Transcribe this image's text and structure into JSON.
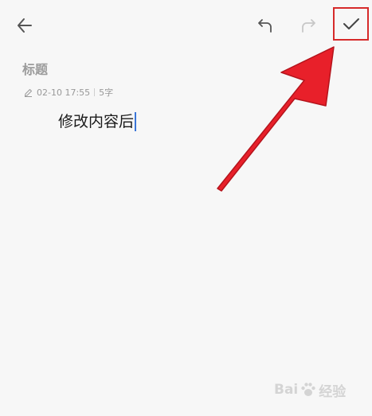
{
  "toolbar": {
    "back_icon": "arrow-left-icon",
    "undo_icon": "undo-icon",
    "redo_icon": "redo-icon",
    "confirm_icon": "checkmark-icon",
    "confirm_highlight_color": "#d62a2a"
  },
  "note": {
    "title": "标题",
    "edit_icon": "pencil-icon",
    "timestamp": "02-10 17:55",
    "char_count": "5字",
    "content": "修改内容后"
  },
  "annotation": {
    "arrow_color": "#e8202a"
  },
  "watermark": {
    "brand_prefix": "Bai",
    "brand_suffix": "经验"
  }
}
